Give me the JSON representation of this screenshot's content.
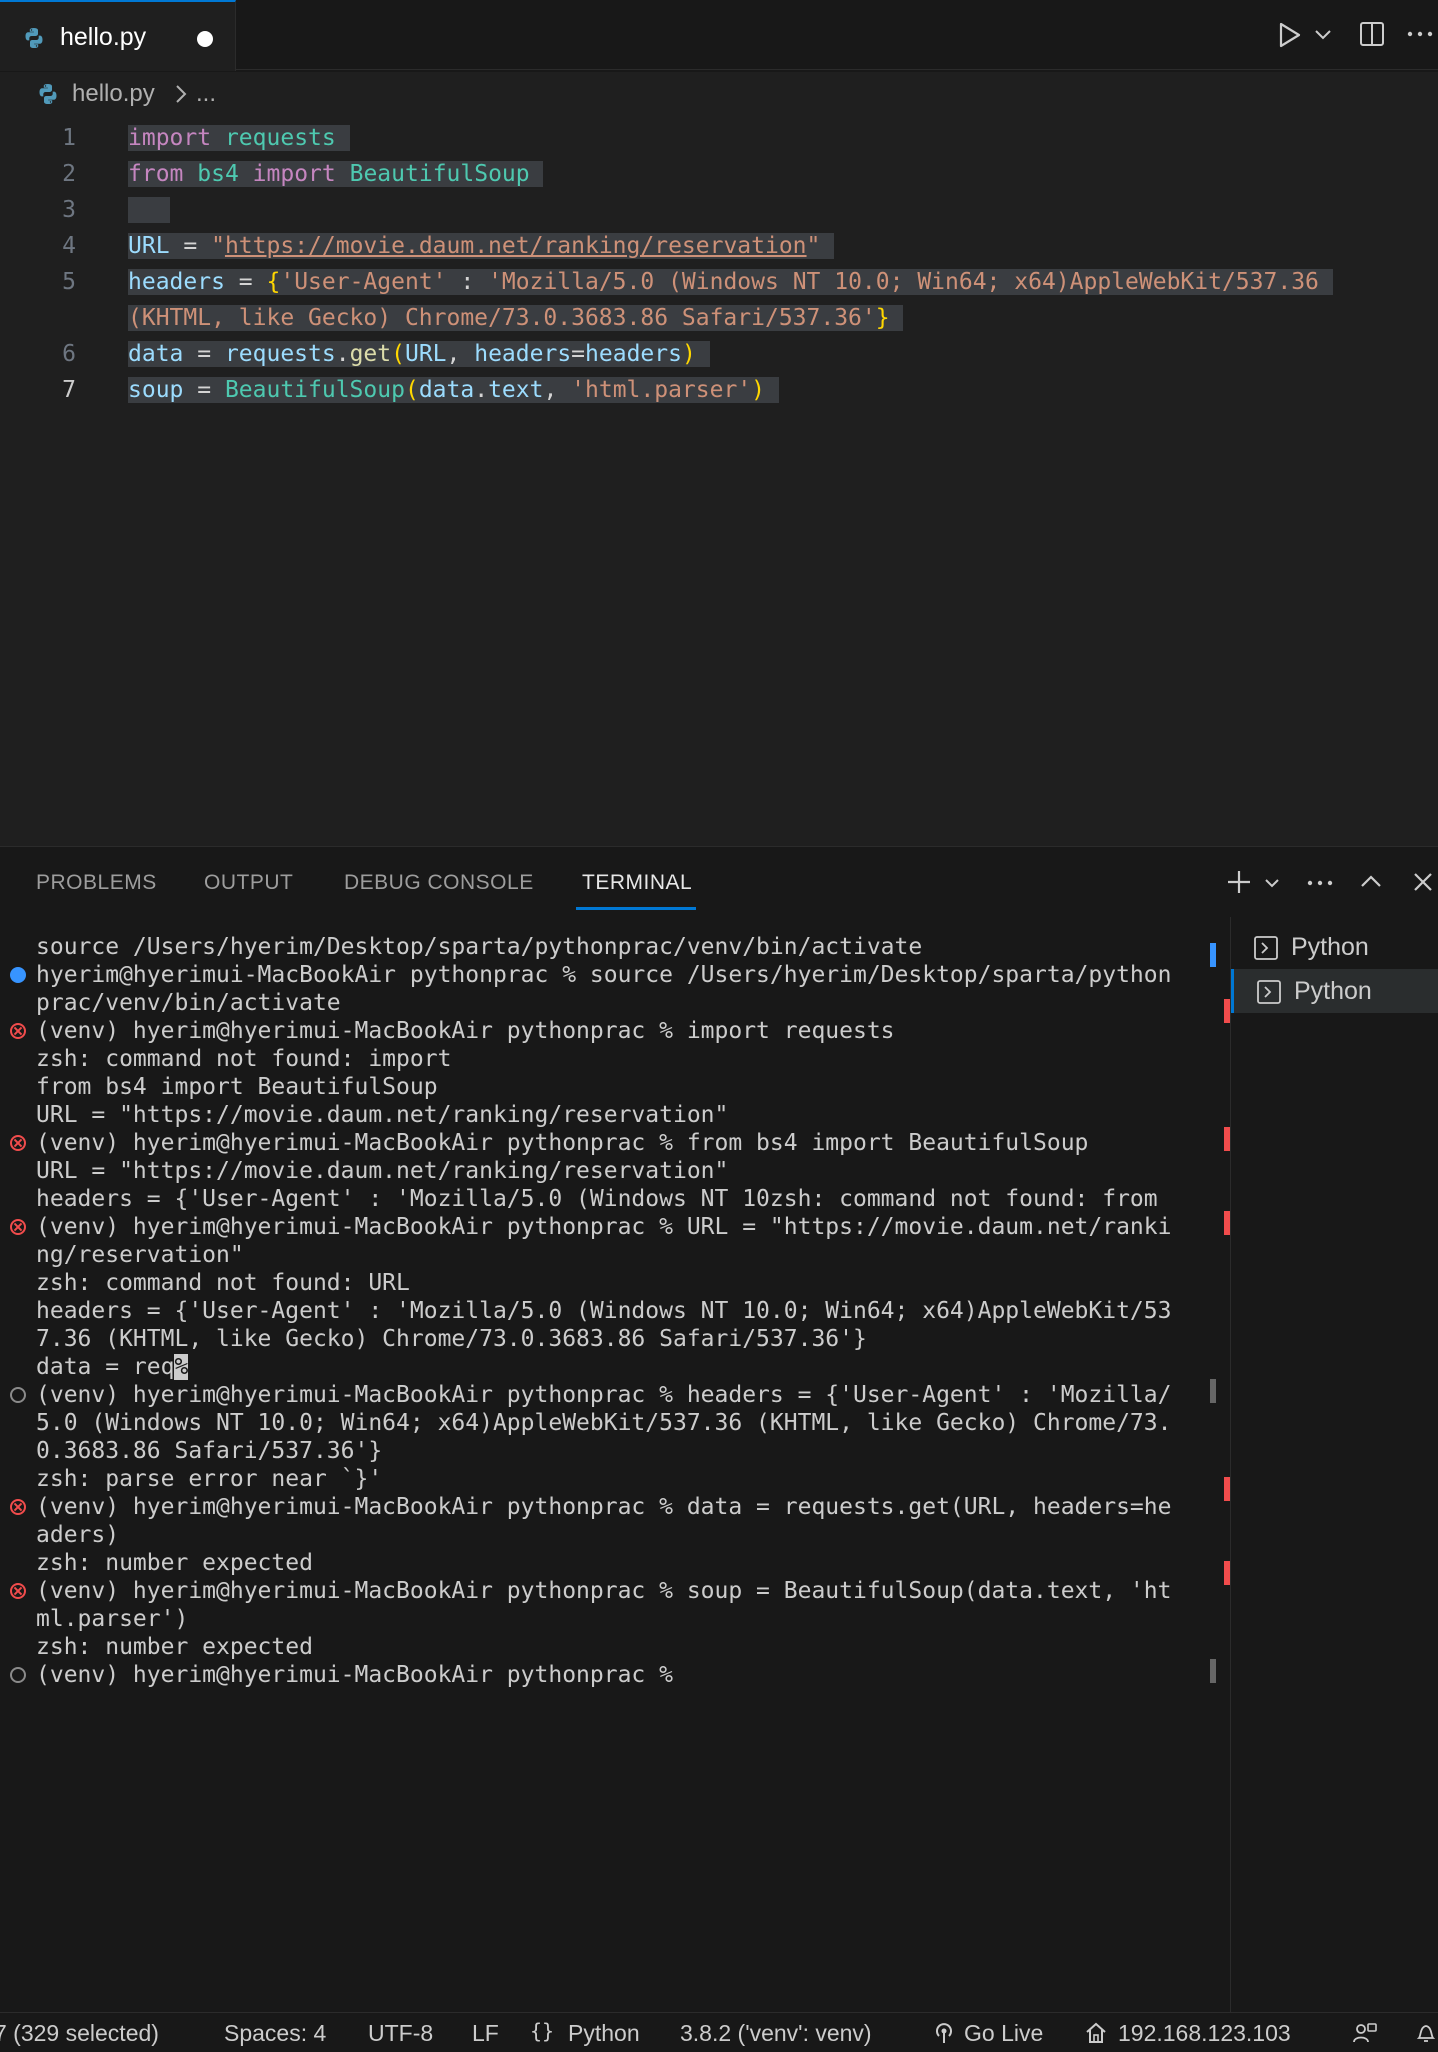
{
  "tab": {
    "filename": "hello.py"
  },
  "breadcrumb": {
    "file": "hello.py",
    "more": "..."
  },
  "editor": {
    "current_line": 7,
    "lines": [
      {
        "num": "1",
        "tokens": [
          [
            "kw",
            "import"
          ],
          [
            "op",
            " "
          ],
          [
            "mod",
            "requests"
          ]
        ]
      },
      {
        "num": "2",
        "tokens": [
          [
            "kw",
            "from"
          ],
          [
            "op",
            " "
          ],
          [
            "mod",
            "bs4"
          ],
          [
            "op",
            " "
          ],
          [
            "kw",
            "import"
          ],
          [
            "op",
            " "
          ],
          [
            "mod",
            "BeautifulSoup"
          ]
        ]
      },
      {
        "num": "3",
        "tokens": []
      },
      {
        "num": "4",
        "tokens": [
          [
            "var",
            "URL"
          ],
          [
            "op",
            " = "
          ],
          [
            "str",
            "\""
          ],
          [
            "url",
            "https://movie.daum.net/ranking/reservation"
          ],
          [
            "str",
            "\""
          ]
        ]
      },
      {
        "num": "5",
        "tokens": [
          [
            "var",
            "headers"
          ],
          [
            "op",
            " = "
          ],
          [
            "br",
            "{"
          ],
          [
            "str",
            "'User-Agent'"
          ],
          [
            "op",
            " : "
          ],
          [
            "str",
            "'Mozilla/5.0 (Windows NT 10.0; Win64; x64)AppleWebKit/537.36"
          ]
        ]
      },
      {
        "num": "",
        "tokens": [
          [
            "str",
            "(KHTML, like Gecko) Chrome/73.0.3683.86 Safari/537.36'"
          ],
          [
            "br",
            "}"
          ]
        ]
      },
      {
        "num": "6",
        "tokens": [
          [
            "var",
            "data"
          ],
          [
            "op",
            " = "
          ],
          [
            "var",
            "requests"
          ],
          [
            "op",
            "."
          ],
          [
            "fn",
            "get"
          ],
          [
            "br",
            "("
          ],
          [
            "var",
            "URL"
          ],
          [
            "op",
            ", "
          ],
          [
            "var",
            "headers"
          ],
          [
            "op",
            "="
          ],
          [
            "var",
            "headers"
          ],
          [
            "br",
            ")"
          ]
        ]
      },
      {
        "num": "7",
        "tokens": [
          [
            "var",
            "soup"
          ],
          [
            "op",
            " = "
          ],
          [
            "mod",
            "BeautifulSoup"
          ],
          [
            "br",
            "("
          ],
          [
            "var",
            "data"
          ],
          [
            "op",
            "."
          ],
          [
            "var",
            "text"
          ],
          [
            "op",
            ", "
          ],
          [
            "str",
            "'html.parser'"
          ],
          [
            "br",
            ")"
          ]
        ]
      }
    ]
  },
  "panel": {
    "tabs": [
      "PROBLEMS",
      "OUTPUT",
      "DEBUG CONSOLE",
      "TERMINAL"
    ],
    "active_tab": "TERMINAL"
  },
  "terminal": {
    "lines": [
      {
        "dec": "",
        "text": "source /Users/hyerim/Desktop/sparta/pythonprac/venv/bin/activate"
      },
      {
        "dec": "ok",
        "text": "hyerim@hyerimui-MacBookAir pythonprac % source /Users/hyerim/Desktop/sparta/python"
      },
      {
        "dec": "",
        "text": "prac/venv/bin/activate"
      },
      {
        "dec": "err",
        "text": "(venv) hyerim@hyerimui-MacBookAir pythonprac % import requests"
      },
      {
        "dec": "",
        "text": "zsh: command not found: import"
      },
      {
        "dec": "",
        "text": "from bs4 import BeautifulSoup"
      },
      {
        "dec": "",
        "text": "URL = \"https://movie.daum.net/ranking/reservation\""
      },
      {
        "dec": "err",
        "text": "(venv) hyerim@hyerimui-MacBookAir pythonprac % from bs4 import BeautifulSoup"
      },
      {
        "dec": "",
        "text": "URL = \"https://movie.daum.net/ranking/reservation\""
      },
      {
        "dec": "",
        "text": "headers = {'User-Agent' : 'Mozilla/5.0 (Windows NT 10zsh: command not found: from"
      },
      {
        "dec": "err",
        "text": "(venv) hyerim@hyerimui-MacBookAir pythonprac % URL = \"https://movie.daum.net/ranki"
      },
      {
        "dec": "",
        "text": "ng/reservation\""
      },
      {
        "dec": "",
        "text": "zsh: command not found: URL"
      },
      {
        "dec": "",
        "text": "headers = {'User-Agent' : 'Mozilla/5.0 (Windows NT 10.0; Win64; x64)AppleWebKit/53"
      },
      {
        "dec": "",
        "text": "7.36 (KHTML, like Gecko) Chrome/73.0.3683.86 Safari/537.36'}"
      },
      {
        "dec": "",
        "text": "data = req",
        "cursor": "%"
      },
      {
        "dec": "empty",
        "text": "(venv) hyerim@hyerimui-MacBookAir pythonprac % headers = {'User-Agent' : 'Mozilla/"
      },
      {
        "dec": "",
        "text": "5.0 (Windows NT 10.0; Win64; x64)AppleWebKit/537.36 (KHTML, like Gecko) Chrome/73."
      },
      {
        "dec": "",
        "text": "0.3683.86 Safari/537.36'}"
      },
      {
        "dec": "",
        "text": "zsh: parse error near `}'"
      },
      {
        "dec": "err",
        "text": "(venv) hyerim@hyerimui-MacBookAir pythonprac % data = requests.get(URL, headers=he"
      },
      {
        "dec": "",
        "text": "aders)"
      },
      {
        "dec": "",
        "text": "zsh: number expected"
      },
      {
        "dec": "err",
        "text": "(venv) hyerim@hyerimui-MacBookAir pythonprac % soup = BeautifulSoup(data.text, 'ht"
      },
      {
        "dec": "",
        "text": "ml.parser')"
      },
      {
        "dec": "",
        "text": "zsh: number expected"
      },
      {
        "dec": "empty",
        "text": "(venv) hyerim@hyerimui-MacBookAir pythonprac %"
      }
    ],
    "instances": [
      "Python",
      "Python"
    ],
    "active_instance": 1
  },
  "status": {
    "selection": "7 (329 selected)",
    "spaces": "Spaces: 4",
    "encoding": "UTF-8",
    "eol": "LF",
    "language": "Python",
    "interpreter": "3.8.2 ('venv': venv)",
    "golive": "Go Live",
    "ip": "192.168.123.103"
  },
  "colors": {
    "accent": "#0078d4",
    "error": "#f14c4c",
    "ok": "#3794ff"
  },
  "icons": [
    "python-file-icon",
    "run-icon",
    "split-editor-icon",
    "more-icon",
    "add-terminal-icon",
    "maximize-icon",
    "close-icon",
    "terminal-icon",
    "braces-icon",
    "broadcast-icon",
    "home-icon",
    "feedback-icon",
    "bell-icon"
  ]
}
